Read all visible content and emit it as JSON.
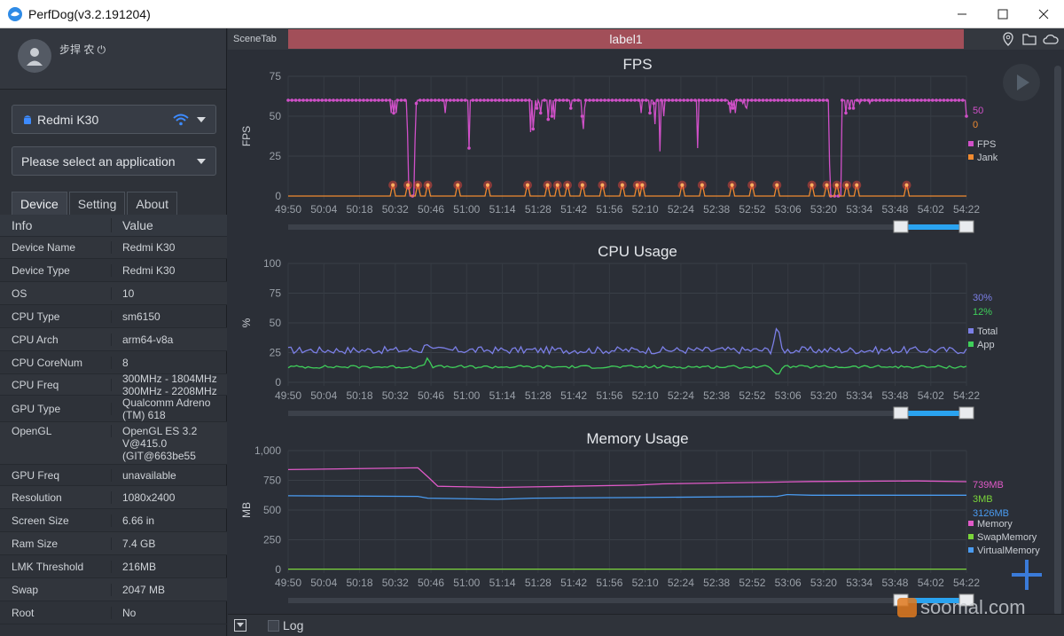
{
  "window": {
    "title": "PerfDog(v3.2.191204)"
  },
  "user": {
    "name": "步捍 农 ⏻"
  },
  "device_select": {
    "value": "Redmi K30"
  },
  "app_select": {
    "value": "Please select an application"
  },
  "tabs": [
    {
      "label": "Device"
    },
    {
      "label": "Setting"
    },
    {
      "label": "About"
    }
  ],
  "info_table": {
    "headers": {
      "col1": "Info",
      "col2": "Value"
    },
    "rows": [
      {
        "key": "Device Name",
        "value": "Redmi K30"
      },
      {
        "key": "Device Type",
        "value": "Redmi K30"
      },
      {
        "key": "OS",
        "value": "10"
      },
      {
        "key": "CPU Type",
        "value": "sm6150"
      },
      {
        "key": "CPU Arch",
        "value": "arm64-v8a"
      },
      {
        "key": "CPU CoreNum",
        "value": "8"
      },
      {
        "key": "CPU Freq",
        "value": "300MHz - 1804MHz\n300MHz - 2208MHz"
      },
      {
        "key": "GPU Type",
        "value": "Qualcomm Adreno\n(TM) 618"
      },
      {
        "key": "OpenGL",
        "value": "OpenGL ES 3.2\nV@415.0\n(GIT@663be55"
      },
      {
        "key": "GPU Freq",
        "value": "unavailable"
      },
      {
        "key": "Resolution",
        "value": "1080x2400"
      },
      {
        "key": "Screen Size",
        "value": "6.66 in"
      },
      {
        "key": "Ram Size",
        "value": "7.4 GB"
      },
      {
        "key": "LMK Threshold",
        "value": "216MB"
      },
      {
        "key": "Swap",
        "value": "2047 MB"
      },
      {
        "key": "Root",
        "value": "No"
      }
    ]
  },
  "scene_tab": {
    "label": "SceneTab",
    "active": "label1"
  },
  "bottom": {
    "log_label": "Log"
  },
  "watermark": {
    "text": "soomal.com"
  },
  "colors": {
    "fps": "#d050c8",
    "jank": "#f08a30",
    "total": "#7b7fe6",
    "app": "#3fcf5a",
    "memory": "#e05ac8",
    "swap": "#7ad43a",
    "virtual": "#4a9bf0"
  },
  "x_ticks": [
    "49:50",
    "50:04",
    "50:18",
    "50:32",
    "50:46",
    "51:00",
    "51:14",
    "51:28",
    "51:42",
    "51:56",
    "52:10",
    "52:24",
    "52:38",
    "52:52",
    "53:06",
    "53:20",
    "53:34",
    "53:48",
    "54:02",
    "54:22"
  ],
  "chart_data": [
    {
      "type": "line",
      "title": "FPS",
      "ylabel": "FPS",
      "ylim": [
        0,
        75
      ],
      "yticks": [
        "0",
        "25",
        "50",
        "75"
      ],
      "grid": true,
      "legend": "right",
      "series": [
        {
          "name": "FPS",
          "current": "50",
          "values": [
            60,
            60,
            60,
            60,
            60,
            60,
            60,
            60,
            60,
            60,
            60,
            60,
            60,
            60,
            60,
            60,
            60,
            60,
            60,
            60,
            60,
            60,
            60,
            60,
            60,
            60,
            60,
            60,
            60,
            60,
            60,
            60,
            60,
            60,
            60,
            60,
            60,
            60,
            60,
            60,
            60,
            60,
            60,
            60,
            60,
            60,
            60,
            60,
            60,
            60,
            60,
            60,
            60,
            60,
            60,
            60,
            60,
            60,
            60,
            60,
            60,
            60,
            60,
            60,
            60,
            60,
            60,
            60,
            60,
            60,
            60,
            60,
            60,
            60,
            60,
            60,
            60,
            60,
            60,
            60,
            60,
            60,
            52,
            60,
            52,
            60,
            52,
            60,
            60,
            60,
            60,
            60,
            60,
            60,
            60,
            40,
            5,
            0,
            0,
            0,
            0,
            35,
            58,
            60,
            60,
            60,
            60,
            60,
            60,
            60,
            60,
            60,
            60,
            60,
            60,
            60,
            60,
            60,
            60,
            60,
            60,
            60,
            60,
            60,
            60,
            52,
            60,
            60,
            60,
            60,
            60,
            60,
            60,
            60,
            60,
            60,
            60,
            60,
            60,
            60,
            60,
            60,
            60,
            60,
            30,
            60,
            60,
            60,
            60,
            60,
            60,
            60,
            60,
            60,
            60,
            60,
            60,
            60,
            60,
            60,
            60,
            60,
            60,
            60,
            60,
            60,
            60,
            60,
            60,
            60,
            60,
            60,
            60,
            60,
            60,
            60,
            60,
            60,
            60,
            60,
            60,
            60,
            60,
            60,
            60,
            60,
            60,
            60,
            60,
            60,
            60,
            60,
            60,
            40,
            60,
            42,
            52,
            60,
            55,
            60,
            58,
            52,
            60,
            60,
            60,
            60,
            60,
            48,
            60,
            60,
            50,
            60,
            48,
            60,
            60,
            60,
            60,
            60,
            60,
            60,
            60,
            60,
            60,
            60,
            60,
            55,
            60,
            60,
            60,
            60,
            60,
            60,
            60,
            60,
            50,
            42,
            55,
            60,
            60,
            60,
            60,
            60,
            60,
            60,
            60,
            60,
            60,
            60,
            60,
            60,
            60,
            60,
            60,
            60,
            60,
            60,
            60,
            60,
            60,
            60,
            60,
            60,
            60,
            60,
            60,
            60,
            60,
            60,
            60,
            60,
            60,
            60,
            60,
            60,
            60,
            60,
            60,
            60,
            60,
            60,
            60,
            52,
            60,
            60,
            60,
            60,
            60,
            60,
            52,
            60,
            60,
            58,
            45,
            60,
            60,
            60,
            28,
            60,
            60,
            50,
            60,
            60,
            60,
            60,
            60,
            60,
            60,
            60,
            60,
            60,
            60,
            60,
            60,
            60,
            60,
            60,
            60,
            60,
            60,
            60,
            60,
            60,
            60,
            60,
            60,
            60,
            30,
            60,
            60,
            60,
            60,
            60,
            60,
            60,
            60,
            60,
            60,
            60,
            60,
            60,
            60,
            60,
            60,
            60,
            60,
            60,
            60,
            60,
            60,
            60,
            60,
            58,
            52,
            60,
            55,
            60,
            52,
            60,
            60,
            60,
            60,
            60,
            58,
            60,
            56,
            55,
            60,
            60,
            60,
            60,
            60,
            60,
            60,
            60,
            60,
            60,
            60,
            60,
            60,
            60,
            60,
            60,
            60,
            60,
            60,
            60,
            60,
            60,
            60,
            60,
            60,
            60,
            60,
            60,
            60,
            60,
            60,
            60,
            60,
            60,
            60,
            60,
            60,
            60,
            60,
            60,
            60,
            60,
            60,
            60,
            60,
            60,
            60,
            60,
            60,
            60,
            60,
            60,
            60,
            60,
            60,
            60,
            60,
            60,
            60,
            60,
            60,
            60,
            60,
            60,
            60,
            20,
            0,
            0,
            0,
            0,
            0,
            0,
            0,
            0,
            0,
            60,
            60,
            60,
            52,
            60,
            60,
            55,
            60,
            60,
            55,
            60,
            60,
            60,
            60,
            58,
            60,
            60,
            60,
            60,
            60,
            60,
            60,
            58,
            60,
            60,
            60,
            60,
            60,
            60,
            60,
            60,
            60,
            60,
            60,
            60,
            60,
            60,
            60,
            60,
            60,
            60,
            60,
            60,
            60,
            60,
            60,
            60,
            60,
            60,
            60,
            60,
            60,
            60,
            60,
            60,
            60,
            60,
            60,
            60,
            60,
            60,
            60,
            60,
            60,
            60,
            60,
            60,
            60,
            60,
            60,
            60,
            60,
            60,
            60,
            60,
            60,
            60,
            60,
            60,
            60,
            60,
            60,
            60,
            60,
            60,
            60,
            60,
            60,
            60,
            60,
            60,
            60,
            60,
            60,
            60,
            60,
            60,
            60,
            60,
            50
          ]
        },
        {
          "name": "Jank",
          "current": "0",
          "spikes": [
            [
              "50:32",
              1
            ],
            [
              "50:38",
              1
            ],
            [
              "50:42",
              1
            ],
            [
              "50:46",
              1
            ],
            [
              "50:58",
              1
            ],
            [
              "51:10",
              1
            ],
            [
              "51:26",
              1
            ],
            [
              "51:34",
              1
            ],
            [
              "51:38",
              1
            ],
            [
              "51:42",
              1
            ],
            [
              "51:48",
              1
            ],
            [
              "51:56",
              1
            ],
            [
              "52:04",
              1
            ],
            [
              "52:10",
              1
            ],
            [
              "52:12",
              1
            ],
            [
              "52:28",
              1
            ],
            [
              "52:36",
              1
            ],
            [
              "52:48",
              1
            ],
            [
              "52:56",
              1
            ],
            [
              "53:06",
              1
            ],
            [
              "53:20",
              1
            ],
            [
              "53:26",
              1
            ],
            [
              "53:30",
              1
            ],
            [
              "53:34",
              1
            ],
            [
              "53:38",
              1
            ],
            [
              "53:58",
              1
            ]
          ]
        }
      ]
    },
    {
      "type": "line",
      "title": "CPU Usage",
      "ylabel": "%",
      "ylim": [
        0,
        100
      ],
      "yticks": [
        "0",
        "25",
        "50",
        "75",
        "100"
      ],
      "grid": true,
      "legend": "right",
      "series": [
        {
          "name": "Total",
          "current": "30%",
          "baseline": 27,
          "spikes": [
            [
              "50:46",
              35
            ],
            [
              "53:06",
              48
            ]
          ]
        },
        {
          "name": "App",
          "current": "12%",
          "baseline": 13,
          "spikes": [
            [
              "50:46",
              20
            ],
            [
              "53:06",
              5
            ]
          ]
        }
      ]
    },
    {
      "type": "line",
      "title": "Memory Usage",
      "ylabel": "MB",
      "ylim": [
        0,
        1000
      ],
      "yticks": [
        "0",
        "250",
        "500",
        "750",
        "1,000"
      ],
      "grid": true,
      "legend": "right",
      "series": [
        {
          "name": "Memory",
          "current": "739MB",
          "points": [
            [
              "49:50",
              840
            ],
            [
              "50:42",
              855
            ],
            [
              "50:46",
              780
            ],
            [
              "50:50",
              700
            ],
            [
              "51:14",
              690
            ],
            [
              "51:28",
              695
            ],
            [
              "52:10",
              710
            ],
            [
              "52:20",
              720
            ],
            [
              "53:06",
              735
            ],
            [
              "53:20",
              740
            ],
            [
              "54:02",
              745
            ],
            [
              "54:22",
              739
            ]
          ]
        },
        {
          "name": "SwapMemory",
          "current": "3MB",
          "points": [
            [
              "49:50",
              3
            ],
            [
              "54:22",
              3
            ]
          ]
        },
        {
          "name": "VirtualMemory",
          "current": "3126MB",
          "points": [
            [
              "49:50",
              620
            ],
            [
              "50:42",
              615
            ],
            [
              "50:46",
              600
            ],
            [
              "51:14",
              590
            ],
            [
              "51:28",
              600
            ],
            [
              "52:10",
              605
            ],
            [
              "53:06",
              615
            ],
            [
              "53:10",
              630
            ],
            [
              "53:20",
              625
            ],
            [
              "54:22",
              625
            ]
          ]
        }
      ]
    }
  ]
}
